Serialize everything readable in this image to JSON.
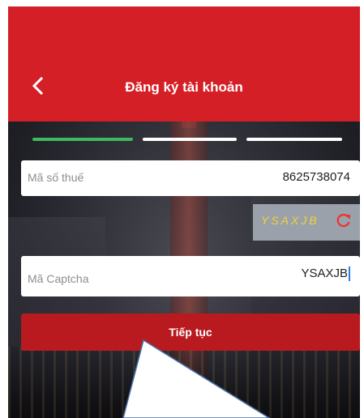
{
  "header": {
    "title": "Đăng ký tài khoản",
    "back_icon": "chevron-left-icon"
  },
  "progress": {
    "total_steps": 3,
    "current_step": 1,
    "active_color": "#3fb85f",
    "inactive_color": "#ffffff"
  },
  "tax_code": {
    "label": "Mã số thuế",
    "value": "8625738074"
  },
  "captcha": {
    "image_text": "YSAXJB",
    "refresh_icon": "refresh-icon"
  },
  "captcha_input": {
    "label": "Mã Captcha",
    "value": "YSAXJB"
  },
  "submit": {
    "label": "Tiếp tục"
  },
  "colors": {
    "brand_red": "#d51f26",
    "button_red": "#b81a1f",
    "captcha_text": "#f0d23a"
  }
}
